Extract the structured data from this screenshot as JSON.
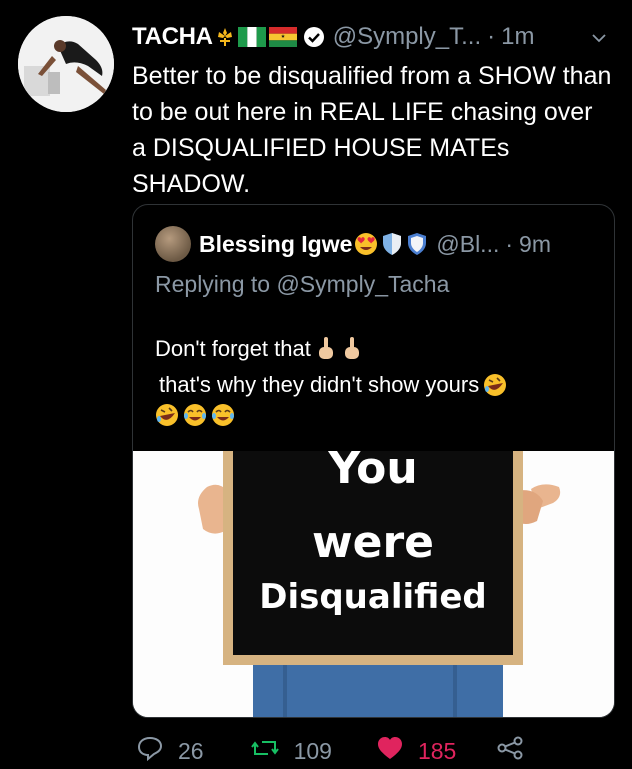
{
  "tweet": {
    "display_name": "TACHA",
    "handle": "@Symply_T...",
    "separator": "·",
    "time": "1m",
    "text": "Better to be disqualified from a SHOW than to be out here in REAL LIFE chasing over a DISQUALIFIED HOUSE MATEs SHADOW.",
    "icons": [
      "fleur-de-lis-icon",
      "nigeria-flag-icon",
      "ghana-flag-icon",
      "verified-badge-icon",
      "chevron-down-icon"
    ]
  },
  "quoted_tweet": {
    "display_name": "Blessing Igwe",
    "handle": "@Bl...",
    "separator": "·",
    "time": "9m",
    "replying_to": "Replying to @Symply_Tacha",
    "line1": "Don't forget that",
    "line2": "that's why they didn't show yours",
    "media_sign": {
      "line1": "You",
      "line2": "were",
      "line3": "Disqualified"
    },
    "icons": [
      "heart-eyes-emoji-icon",
      "blue-shield-icon",
      "blue-shield-icon",
      "middle-finger-emoji-icon",
      "rolling-laugh-emoji-icon",
      "tears-of-joy-emoji-icon"
    ]
  },
  "actions": {
    "replies": "26",
    "retweets": "109",
    "likes": "185"
  },
  "colors": {
    "background": "#000000",
    "secondary_text": "#8b98a5",
    "retweet": "#17bf63",
    "like": "#e0245e",
    "border": "#2f3336"
  }
}
